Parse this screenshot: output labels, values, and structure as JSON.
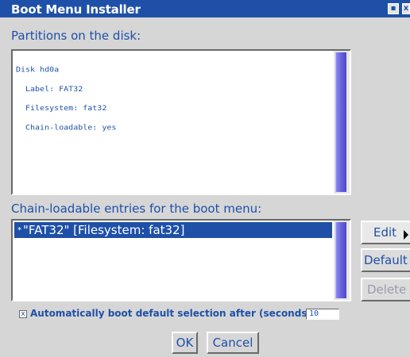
{
  "window": {
    "title": "Boot Menu Installer",
    "minimize_symbol": "▪",
    "close_symbol": "x"
  },
  "partitions": {
    "label": "Partitions on the disk:",
    "lines": [
      "Disk hd0a",
      "Label: FAT32",
      "Filesystem: fat32",
      "Chain-loadable: yes"
    ]
  },
  "entries": {
    "label": "Chain-loadable entries for the boot menu:",
    "items": [
      {
        "marker": "*",
        "text": "\"FAT32\" [Filesystem: fat32]",
        "selected": true
      }
    ]
  },
  "buttons": {
    "edit": "Edit",
    "default": "Default",
    "delete": "Delete",
    "ok": "OK",
    "cancel": "Cancel"
  },
  "autoboot": {
    "checked": true,
    "check_mark": "x",
    "label": "Automatically boot default selection after (seconds)",
    "seconds": "10"
  },
  "colors": {
    "accent": "#1e50a8",
    "background": "#d6d6d6",
    "scrollbar": "#6a64e0",
    "disabled_text": "#9a9ab0"
  },
  "icons": {
    "pointer": "mouse-pointer-icon"
  }
}
